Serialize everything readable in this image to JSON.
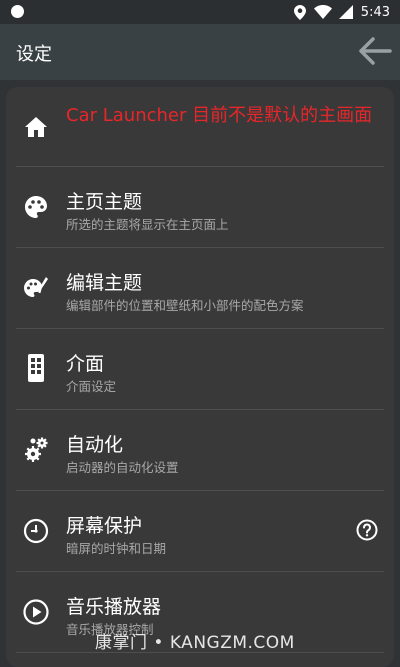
{
  "status": {
    "time": "5:43"
  },
  "toolbar": {
    "title": "设定"
  },
  "items": [
    {
      "title": "Car Launcher 目前不是默认的主画面",
      "icon": "home-icon"
    },
    {
      "title": "主页主题",
      "subtitle": "所选的主题将显示在主页面上",
      "icon": "palette-icon"
    },
    {
      "title": "编辑主题",
      "subtitle": "编辑部件的位置和壁纸和小部件的配色方案",
      "icon": "palette-brush-icon"
    },
    {
      "title": "介面",
      "subtitle": "介面设定",
      "icon": "phone-grid-icon"
    },
    {
      "title": "自动化",
      "subtitle": "启动器的自动化设置",
      "icon": "gears-icon"
    },
    {
      "title": "屏幕保护",
      "subtitle": "暗屏的时钟和日期",
      "icon": "clock-icon"
    },
    {
      "title": "音乐播放器",
      "subtitle": "音乐播放器控制",
      "icon": "play-circle-icon"
    }
  ],
  "watermark": "康掌门 • KANGZM.COM",
  "colors": {
    "warning": "#e8262a",
    "background": "#2f3336",
    "card": "#393939",
    "toolbar": "#3a4145"
  }
}
